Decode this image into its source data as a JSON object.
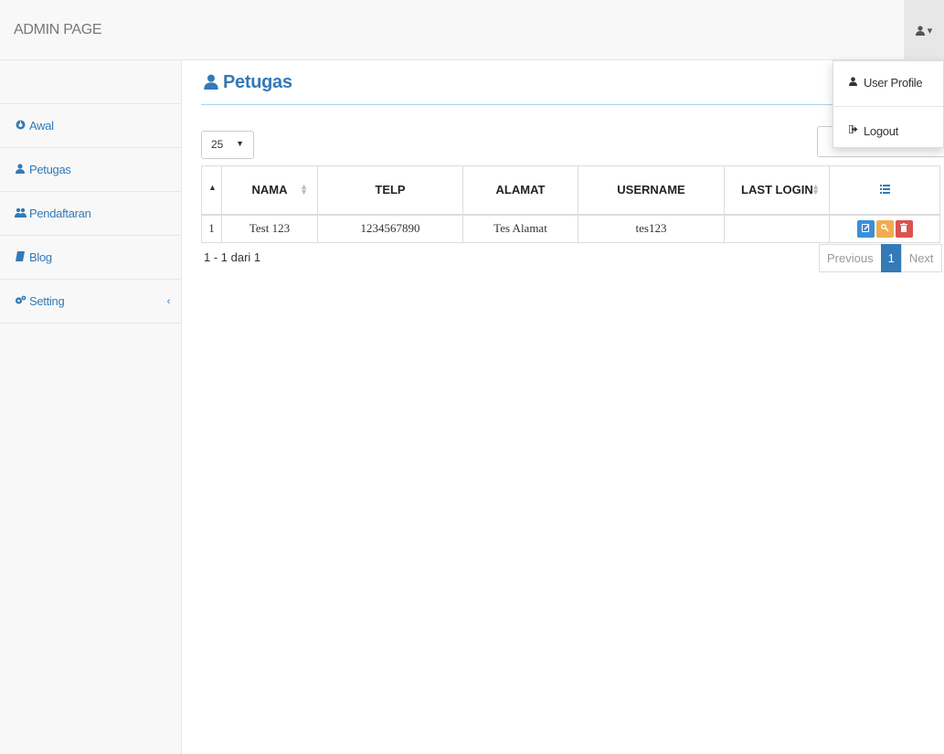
{
  "header": {
    "brand": "ADMIN PAGE",
    "user_icon": "user-icon",
    "caret": "▾"
  },
  "sidebar": {
    "items": [
      {
        "label": "Awal",
        "icon": "dashboard-icon",
        "glyph": "⚙"
      },
      {
        "label": "Petugas",
        "icon": "user-icon",
        "glyph": "👤"
      },
      {
        "label": "Pendaftaran",
        "icon": "users-icon",
        "glyph": "👥"
      },
      {
        "label": "Blog",
        "icon": "book-icon",
        "glyph": "▮"
      },
      {
        "label": "Setting",
        "icon": "gears-icon",
        "glyph": "⚙",
        "chevron": "‹"
      }
    ]
  },
  "main": {
    "title": "Petugas",
    "title_icon": "user-icon",
    "page_length": "25",
    "table": {
      "headers": [
        "",
        "NAMA",
        "TELP",
        "ALAMAT",
        "USERNAME",
        "LAST LOGIN",
        ""
      ],
      "action_header_icon": "list-icon",
      "rows": [
        {
          "no": "1",
          "nama": "Test 123",
          "telp": "1234567890",
          "alamat": "Tes Alamat",
          "username": "tes123",
          "last_login": ""
        }
      ]
    },
    "info": "1 - 1 dari 1",
    "pagination": {
      "previous": "Previous",
      "current": "1",
      "next": "Next"
    }
  },
  "dropdown": {
    "items": [
      {
        "label": "User Profile",
        "icon": "user-icon"
      },
      {
        "label": "Logout",
        "icon": "sign-out-icon"
      }
    ]
  },
  "colors": {
    "primary": "#337ab7",
    "edit": "#3a8fd9",
    "key": "#f0ad4e",
    "delete": "#d9534f"
  }
}
